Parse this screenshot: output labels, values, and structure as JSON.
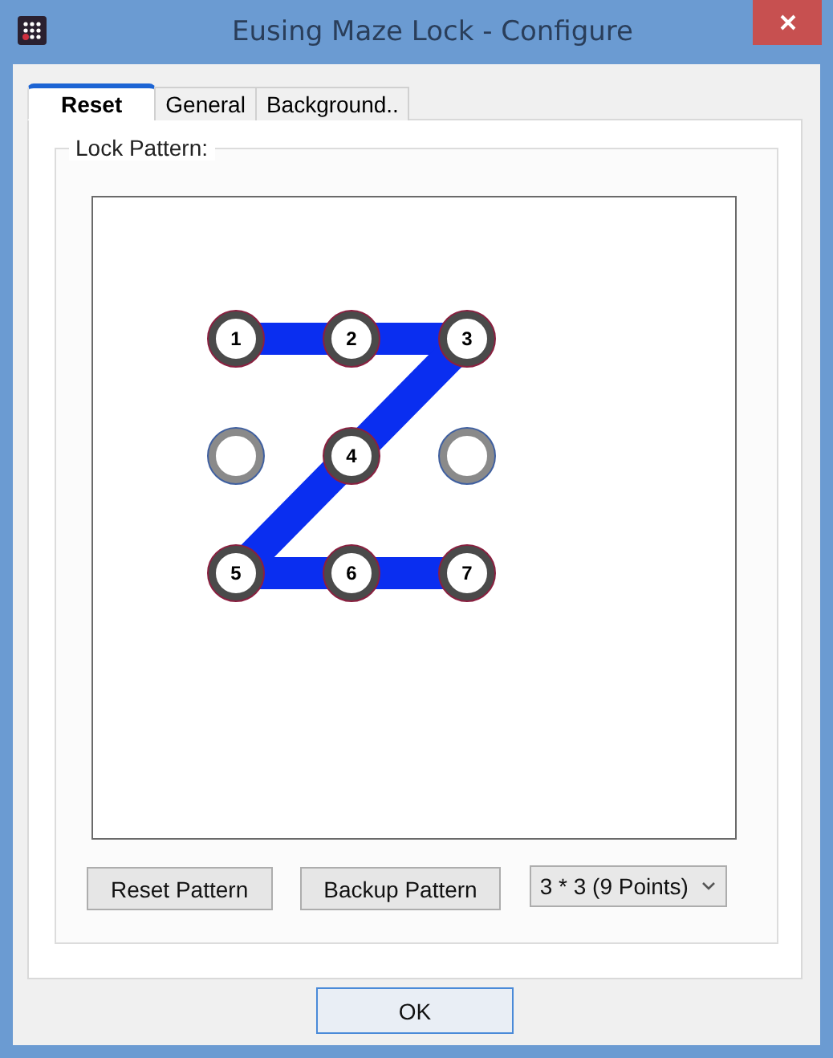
{
  "window": {
    "title": "Eusing Maze Lock - Configure"
  },
  "tabs": [
    {
      "label": "Reset",
      "selected": true
    },
    {
      "label": "General",
      "selected": false
    },
    {
      "label": "Background..",
      "selected": false
    }
  ],
  "group": {
    "title": "Lock Pattern:"
  },
  "pattern": {
    "rows": [
      [
        {
          "label": "1",
          "selected": true,
          "link_right": true,
          "link_down_left": false
        },
        {
          "label": "2",
          "selected": true,
          "link_right": true,
          "link_down_left": false
        },
        {
          "label": "3",
          "selected": true,
          "link_right": false,
          "link_down_left": true
        }
      ],
      [
        {
          "selected": false,
          "link_right": false,
          "link_down_left": false
        },
        {
          "label": "4",
          "selected": true,
          "link_right": false,
          "link_down_left": true
        },
        {
          "selected": false,
          "link_right": false,
          "link_down_left": false
        }
      ],
      [
        {
          "label": "5",
          "selected": true,
          "link_right": true,
          "link_down_left": false
        },
        {
          "label": "6",
          "selected": true,
          "link_right": true,
          "link_down_left": false
        },
        {
          "label": "7",
          "selected": true,
          "link_right": false,
          "link_down_left": false
        }
      ]
    ]
  },
  "buttons": [
    "Reset Pattern",
    "Backup Pattern"
  ],
  "grid_select": {
    "value": "3 * 3 (9 Points)"
  },
  "ok_button": "OK"
}
